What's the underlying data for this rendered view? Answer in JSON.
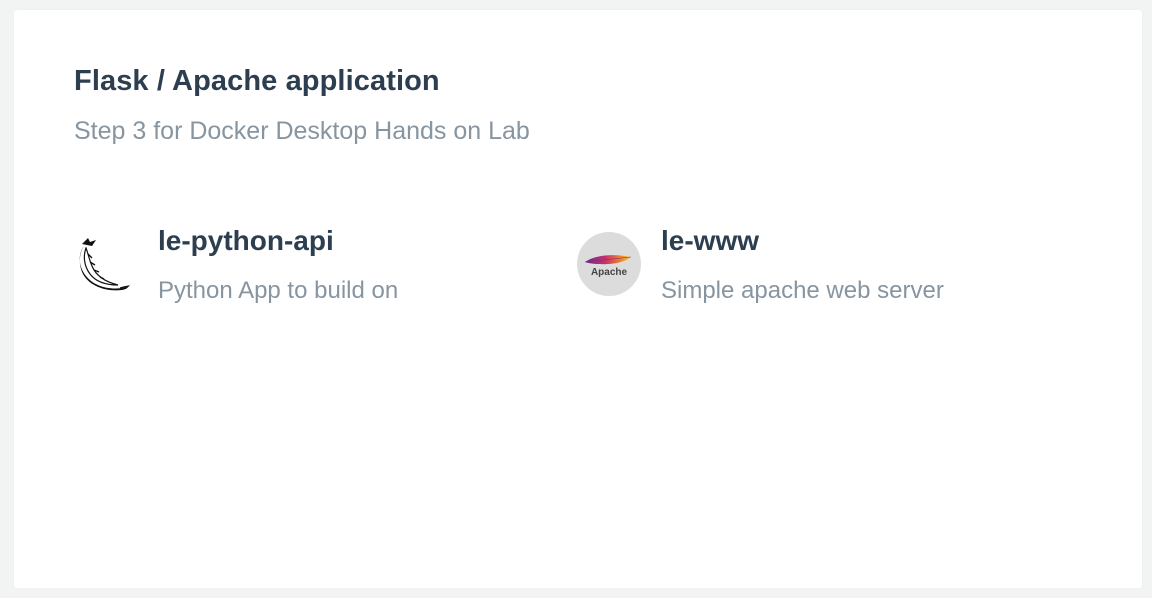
{
  "app": {
    "title": "Flask / Apache application",
    "subtitle": "Step 3 for Docker Desktop Hands on Lab"
  },
  "services": [
    {
      "name": "le-python-api",
      "description": "Python App to build on",
      "icon": "flask-icon"
    },
    {
      "name": "le-www",
      "description": "Simple apache web server",
      "icon": "apache-feather-icon",
      "icon_text": "Apache"
    }
  ],
  "colors": {
    "title": "#2c3e50",
    "muted": "#8795a1",
    "background": "#f2f3f3",
    "card": "#ffffff"
  }
}
